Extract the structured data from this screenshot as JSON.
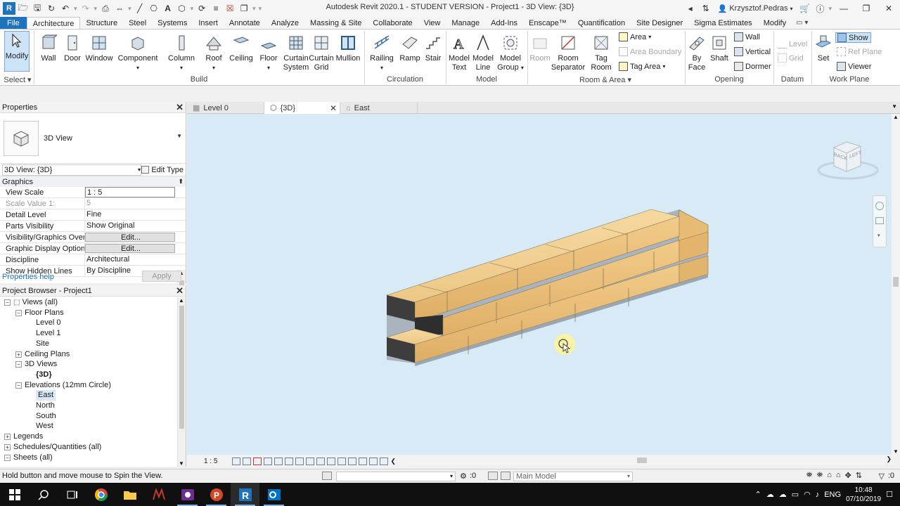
{
  "titlebar": {
    "title": "Autodesk Revit 2020.1 - STUDENT VERSION - Project1 - 3D View: {3D}",
    "user": "Krzysztof.Pedras"
  },
  "ribbon_tabs": [
    "File",
    "Architecture",
    "Structure",
    "Steel",
    "Systems",
    "Insert",
    "Annotate",
    "Analyze",
    "Massing & Site",
    "Collaborate",
    "View",
    "Manage",
    "Add-Ins",
    "Enscape™",
    "Quantification",
    "Site Designer",
    "Sigma Estimates",
    "Modify"
  ],
  "ribbon": {
    "modify": "Modify",
    "select": "Select",
    "build": {
      "label": "Build",
      "wall": "Wall",
      "door": "Door",
      "window": "Window",
      "component": "Component",
      "column": "Column",
      "roof": "Roof",
      "ceiling": "Ceiling",
      "floor": "Floor",
      "curtain_system": [
        "Curtain",
        "System"
      ],
      "curtain_grid": [
        "Curtain",
        "Grid"
      ],
      "mullion": "Mullion"
    },
    "circulation": {
      "label": "Circulation",
      "railing": "Railing",
      "ramp": "Ramp",
      "stair": "Stair"
    },
    "model": {
      "label": "Model",
      "model_text": [
        "Model",
        "Text"
      ],
      "model_line": [
        "Model",
        "Line"
      ],
      "model_group": [
        "Model",
        "Group"
      ]
    },
    "room_area": {
      "label": "Room & Area",
      "room": "Room",
      "room_separator": [
        "Room",
        "Separator"
      ],
      "tag_room": [
        "Tag",
        "Room"
      ],
      "area": "Area",
      "area_boundary": "Area  Boundary",
      "tag_area": "Tag  Area"
    },
    "opening": {
      "label": "Opening",
      "by_face": [
        "By",
        "Face"
      ],
      "shaft": "Shaft",
      "wall": "Wall",
      "vertical": "Vertical",
      "dormer": "Dormer"
    },
    "datum": {
      "label": "Datum",
      "level": "Level",
      "grid": "Grid"
    },
    "work_plane": {
      "label": "Work Plane",
      "set": "Set",
      "show": "Show",
      "ref_plane": "Ref  Plane",
      "viewer": "Viewer"
    }
  },
  "properties": {
    "header": "Properties",
    "type_name": "3D View",
    "view_selector": "3D View: {3D}",
    "edit_type": "Edit Type",
    "group": "Graphics",
    "rows": [
      {
        "name": "View Scale",
        "value": "1 : 5"
      },
      {
        "name": "Scale Value    1:",
        "value": "5"
      },
      {
        "name": "Detail Level",
        "value": "Fine"
      },
      {
        "name": "Parts Visibility",
        "value": "Show Original"
      },
      {
        "name": "Visibility/Graphics Over...",
        "value": "Edit..."
      },
      {
        "name": "Graphic Display Options",
        "value": "Edit..."
      },
      {
        "name": "Discipline",
        "value": "Architectural"
      },
      {
        "name": "Show Hidden Lines",
        "value": "By Discipline"
      }
    ],
    "help": "Properties help",
    "apply": "Apply"
  },
  "browser": {
    "header": "Project Browser - Project1",
    "items": [
      {
        "label": "Views (all)",
        "level": 0,
        "toggle": "−"
      },
      {
        "label": "Floor Plans",
        "level": 1,
        "toggle": "−"
      },
      {
        "label": "Level 0",
        "level": 2,
        "toggle": ""
      },
      {
        "label": "Level 1",
        "level": 2,
        "toggle": ""
      },
      {
        "label": "Site",
        "level": 2,
        "toggle": ""
      },
      {
        "label": "Ceiling Plans",
        "level": 1,
        "toggle": "+"
      },
      {
        "label": "3D Views",
        "level": 1,
        "toggle": "−"
      },
      {
        "label": "{3D}",
        "level": 2,
        "toggle": "",
        "bold": true
      },
      {
        "label": "Elevations (12mm Circle)",
        "level": 1,
        "toggle": "−"
      },
      {
        "label": "East",
        "level": 2,
        "toggle": "",
        "selected": true
      },
      {
        "label": "North",
        "level": 2,
        "toggle": ""
      },
      {
        "label": "South",
        "level": 2,
        "toggle": ""
      },
      {
        "label": "West",
        "level": 2,
        "toggle": ""
      },
      {
        "label": "Legends",
        "level": 0,
        "toggle": "+"
      },
      {
        "label": "Schedules/Quantities (all)",
        "level": 0,
        "toggle": "+"
      },
      {
        "label": "Sheets (all)",
        "level": 0,
        "toggle": "−"
      }
    ]
  },
  "view_tabs": [
    "Level 0",
    "{3D}",
    "East"
  ],
  "viewcube": {
    "back": "BACK",
    "left": "LEFT"
  },
  "view_control": {
    "scale": "1 : 5"
  },
  "status": {
    "message": "Hold button and move mouse to Spin the View.",
    "selection_count": ":0",
    "model": "Main Model",
    "filter_count": ":0"
  },
  "taskbar": {
    "lang": "ENG",
    "time": "10:48",
    "date": "07/10/2019"
  }
}
